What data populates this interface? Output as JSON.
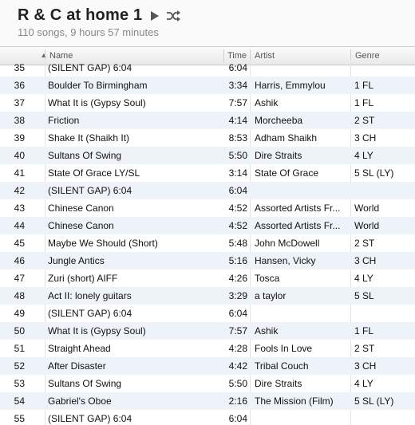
{
  "playlist": {
    "title": "R & C at home 1",
    "summary": "110 songs, 9 hours 57 minutes"
  },
  "columns": {
    "name": "Name",
    "time": "Time",
    "artist": "Artist",
    "genre": "Genre"
  },
  "tracks": [
    {
      "num": "35",
      "name": "(SILENT GAP)   6:04",
      "time": "6:04",
      "artist": "",
      "genre": ""
    },
    {
      "num": "36",
      "name": "Boulder To Birmingham",
      "time": "3:34",
      "artist": "Harris, Emmylou",
      "genre": "1 FL"
    },
    {
      "num": "37",
      "name": "What It is (Gypsy Soul)",
      "time": "7:57",
      "artist": "Ashik",
      "genre": "1 FL"
    },
    {
      "num": "38",
      "name": "Friction",
      "time": "4:14",
      "artist": "Morcheeba",
      "genre": "2 ST"
    },
    {
      "num": "39",
      "name": "Shake It (Shaikh It)",
      "time": "8:53",
      "artist": "Adham Shaikh",
      "genre": "3 CH"
    },
    {
      "num": "40",
      "name": "Sultans Of Swing",
      "time": "5:50",
      "artist": "Dire Straits",
      "genre": "4 LY"
    },
    {
      "num": "41",
      "name": "State Of Grace LY/SL",
      "time": "3:14",
      "artist": "State Of Grace",
      "genre": "5 SL (LY)"
    },
    {
      "num": "42",
      "name": "(SILENT GAP)   6:04",
      "time": "6:04",
      "artist": "",
      "genre": ""
    },
    {
      "num": "43",
      "name": "Chinese Canon",
      "time": "4:52",
      "artist": "Assorted Artists Fr...",
      "genre": "World"
    },
    {
      "num": "44",
      "name": "Chinese Canon",
      "time": "4:52",
      "artist": "Assorted Artists Fr...",
      "genre": "World"
    },
    {
      "num": "45",
      "name": "Maybe We Should (Short)",
      "time": "5:48",
      "artist": "John McDowell",
      "genre": "2 ST"
    },
    {
      "num": "46",
      "name": "Jungle Antics",
      "time": "5:16",
      "artist": "Hansen, Vicky",
      "genre": "3 CH"
    },
    {
      "num": "47",
      "name": "Zuri (short) AIFF",
      "time": "4:26",
      "artist": "Tosca",
      "genre": "4 LY"
    },
    {
      "num": "48",
      "name": "Act II: lonely guitars",
      "time": "3:29",
      "artist": "a taylor",
      "genre": "5 SL"
    },
    {
      "num": "49",
      "name": "(SILENT GAP)   6:04",
      "time": "6:04",
      "artist": "",
      "genre": ""
    },
    {
      "num": "50",
      "name": "What It is (Gypsy Soul)",
      "time": "7:57",
      "artist": "Ashik",
      "genre": "1 FL"
    },
    {
      "num": "51",
      "name": "Straight Ahead",
      "time": "4:28",
      "artist": "Fools In Love",
      "genre": "2 ST"
    },
    {
      "num": "52",
      "name": "After Disaster",
      "time": "4:42",
      "artist": "Tribal Couch",
      "genre": "3 CH"
    },
    {
      "num": "53",
      "name": "Sultans Of Swing",
      "time": "5:50",
      "artist": "Dire Straits",
      "genre": "4 LY"
    },
    {
      "num": "54",
      "name": "Gabriel's Oboe",
      "time": "2:16",
      "artist": "The Mission (Film)",
      "genre": "5 SL (LY)"
    },
    {
      "num": "55",
      "name": "(SILENT GAP)   6:04",
      "time": "6:04",
      "artist": "",
      "genre": ""
    }
  ],
  "colors": {
    "alt_row": "#eef3fa",
    "header_bg": "#e9e9e9"
  },
  "icons": {
    "play": "play-icon",
    "shuffle": "shuffle-icon"
  }
}
